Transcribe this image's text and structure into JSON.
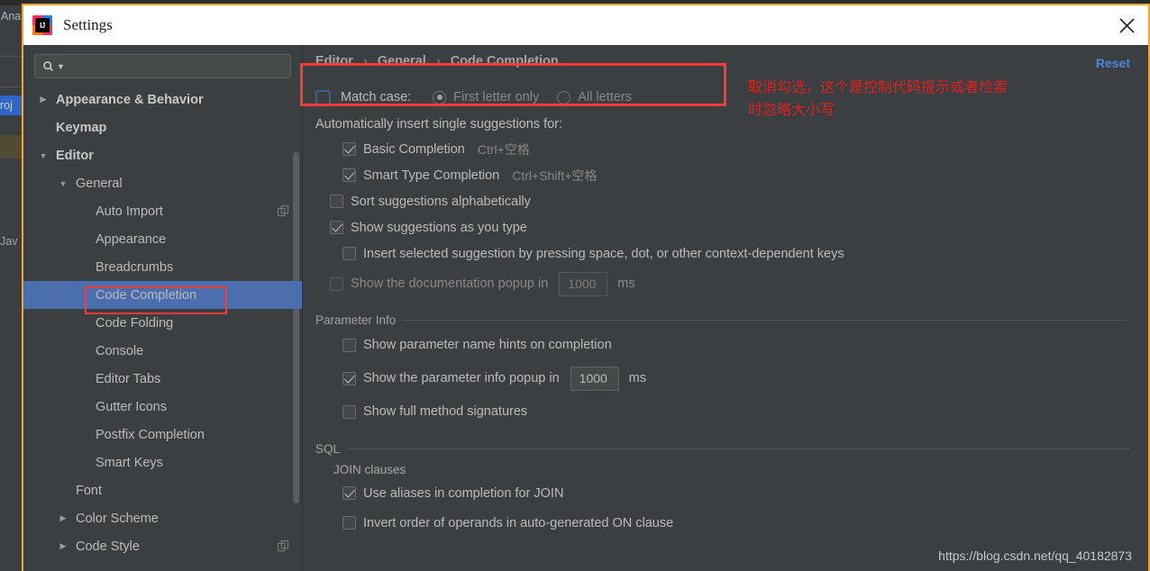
{
  "background_ide": {
    "menu_text": "Ana",
    "project_tab": "roj",
    "java_label": "Jav"
  },
  "window": {
    "title": "Settings",
    "logo_text": "IJ",
    "close_icon": "close-icon"
  },
  "sidebar": {
    "search": {
      "placeholder": "",
      "value": "",
      "icon": "search-icon"
    },
    "items": [
      {
        "label": "Appearance & Behavior",
        "arrow": "collapsed",
        "indent": 0,
        "bold": true,
        "selected": false,
        "copy": false
      },
      {
        "label": "Keymap",
        "arrow": "none",
        "indent": 0,
        "bold": true,
        "selected": false,
        "copy": false
      },
      {
        "label": "Editor",
        "arrow": "expanded",
        "indent": 0,
        "bold": true,
        "selected": false,
        "copy": false
      },
      {
        "label": "General",
        "arrow": "expanded",
        "indent": 1,
        "bold": false,
        "selected": false,
        "copy": false
      },
      {
        "label": "Auto Import",
        "arrow": "none",
        "indent": 2,
        "bold": false,
        "selected": false,
        "copy": true
      },
      {
        "label": "Appearance",
        "arrow": "none",
        "indent": 2,
        "bold": false,
        "selected": false,
        "copy": false
      },
      {
        "label": "Breadcrumbs",
        "arrow": "none",
        "indent": 2,
        "bold": false,
        "selected": false,
        "copy": false
      },
      {
        "label": "Code Completion",
        "arrow": "none",
        "indent": 2,
        "bold": false,
        "selected": true,
        "copy": false
      },
      {
        "label": "Code Folding",
        "arrow": "none",
        "indent": 2,
        "bold": false,
        "selected": false,
        "copy": false
      },
      {
        "label": "Console",
        "arrow": "none",
        "indent": 2,
        "bold": false,
        "selected": false,
        "copy": false
      },
      {
        "label": "Editor Tabs",
        "arrow": "none",
        "indent": 2,
        "bold": false,
        "selected": false,
        "copy": false
      },
      {
        "label": "Gutter Icons",
        "arrow": "none",
        "indent": 2,
        "bold": false,
        "selected": false,
        "copy": false
      },
      {
        "label": "Postfix Completion",
        "arrow": "none",
        "indent": 2,
        "bold": false,
        "selected": false,
        "copy": false
      },
      {
        "label": "Smart Keys",
        "arrow": "none",
        "indent": 2,
        "bold": false,
        "selected": false,
        "copy": false
      },
      {
        "label": "Font",
        "arrow": "none",
        "indent": 1,
        "bold": false,
        "selected": false,
        "copy": false
      },
      {
        "label": "Color Scheme",
        "arrow": "collapsed",
        "indent": 1,
        "bold": false,
        "selected": false,
        "copy": false
      },
      {
        "label": "Code Style",
        "arrow": "collapsed",
        "indent": 1,
        "bold": false,
        "selected": false,
        "copy": true
      }
    ]
  },
  "main": {
    "breadcrumb": {
      "part1": "Editor",
      "part2": "General",
      "part3": "Code Completion",
      "separator": "›"
    },
    "reset_label": "Reset",
    "match_case": {
      "label": "Match case:",
      "checked": false,
      "radio_first_letter": "First letter only",
      "radio_all_letters": "All letters",
      "selected_radio": "First letter only"
    },
    "auto_insert_header": "Automatically insert single suggestions for:",
    "basic_completion": {
      "label": "Basic Completion",
      "shortcut": "Ctrl+空格",
      "checked": true
    },
    "smart_type_completion": {
      "label": "Smart Type Completion",
      "shortcut": "Ctrl+Shift+空格",
      "checked": true
    },
    "sort_alphabetically": {
      "label": "Sort suggestions alphabetically",
      "checked": false
    },
    "show_as_you_type": {
      "label": "Show suggestions as you type",
      "checked": true
    },
    "insert_selected": {
      "label": "Insert selected suggestion by pressing space, dot, or other context-dependent keys",
      "checked": false
    },
    "doc_popup": {
      "label": "Show the documentation popup in",
      "checked": false,
      "value": "1000",
      "unit": "ms"
    },
    "parameter_info": {
      "section_title": "Parameter Info",
      "name_hints": {
        "label": "Show parameter name hints on completion",
        "checked": false
      },
      "info_popup": {
        "label": "Show the parameter info popup in",
        "checked": true,
        "value": "1000",
        "unit": "ms"
      },
      "full_signatures": {
        "label": "Show full method signatures",
        "checked": false
      }
    },
    "sql": {
      "section_title": "SQL",
      "join_clauses_label": "JOIN clauses",
      "use_aliases": {
        "label": "Use aliases in completion for JOIN",
        "checked": true
      },
      "invert_order": {
        "label": "Invert order of operands in auto-generated ON clause",
        "checked": false
      }
    }
  },
  "annotations": {
    "chinese_note": "取消勾选，这个是控制代码提示或者检索时忽略大小写",
    "highlight_color": "#fc3a36",
    "note_color": "#e02020"
  },
  "watermark": {
    "text": "https://blog.csdn.net/qq_40182873"
  }
}
